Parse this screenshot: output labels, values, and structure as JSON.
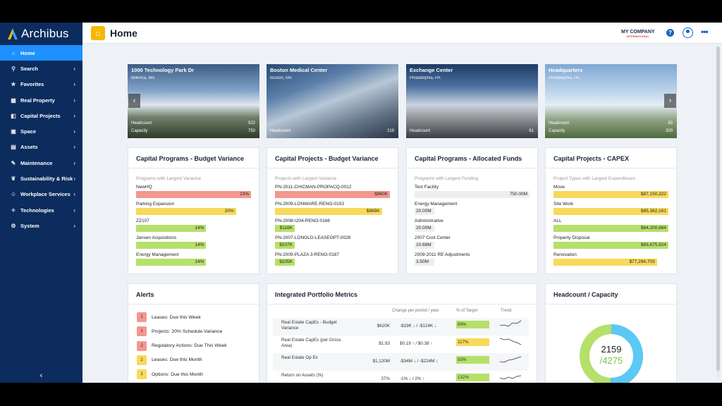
{
  "app": {
    "name": "Archibus"
  },
  "sidebar": {
    "items": [
      {
        "label": "Home",
        "icon": "home-icon",
        "glyph": "⌂",
        "active": true
      },
      {
        "label": "Search",
        "icon": "search-icon",
        "glyph": "⚲"
      },
      {
        "label": "Favorites",
        "icon": "star-icon",
        "glyph": "★"
      },
      {
        "label": "Real Property",
        "icon": "building-icon",
        "glyph": "▦"
      },
      {
        "label": "Capital Projects",
        "icon": "chart-icon",
        "glyph": "◧"
      },
      {
        "label": "Space",
        "icon": "space-icon",
        "glyph": "▣"
      },
      {
        "label": "Assets",
        "icon": "assets-icon",
        "glyph": "▤"
      },
      {
        "label": "Maintenance",
        "icon": "wrench-icon",
        "glyph": "✎"
      },
      {
        "label": "Sustainability & Risk",
        "icon": "leaf-icon",
        "glyph": "❦"
      },
      {
        "label": "Workplace Services",
        "icon": "people-icon",
        "glyph": "☺"
      },
      {
        "label": "Technologies",
        "icon": "bulb-icon",
        "glyph": "✧"
      },
      {
        "label": "System",
        "icon": "gear-icon",
        "glyph": "⚙"
      }
    ],
    "collapse_glyph": "‹"
  },
  "header": {
    "title": "Home",
    "company": "MY COMPANY",
    "company_sub": "INTERNATIONAL",
    "help": "?",
    "more": "•••"
  },
  "tiles": [
    {
      "name": "1000 Technology Park Dr",
      "sub": "Billerica, MA",
      "rows": [
        {
          "label": "Headcount",
          "value": "522"
        },
        {
          "label": "Capacity",
          "value": "750"
        }
      ]
    },
    {
      "name": "Boston Medical Center",
      "sub": "Boston, MA",
      "rows": [
        {
          "label": "Headcount",
          "value": "219"
        }
      ]
    },
    {
      "name": "Exchange Center",
      "sub": "Philadelphia, PA",
      "rows": [
        {
          "label": "Headcount",
          "value": "61"
        }
      ]
    },
    {
      "name": "Headquarters",
      "sub": "Philadelphia, PA",
      "rows": [
        {
          "label": "Headcount",
          "value": "83"
        },
        {
          "label": "Capacity",
          "value": "300"
        }
      ]
    }
  ],
  "tile_nav": {
    "prev": "‹",
    "next": "›"
  },
  "cards": [
    {
      "title": "Capital Programs - Budget Variance",
      "subtitle": "Programs with Largest Variance",
      "rows": [
        {
          "label": "NewHQ",
          "display": "23%",
          "fraction": 1.0,
          "color": "#f4978e"
        },
        {
          "label": "Parking Expansion",
          "display": "20%",
          "fraction": 0.87,
          "color": "#f8d95a"
        },
        {
          "label": "ZZ107",
          "display": "14%",
          "fraction": 0.61,
          "color": "#b5e06a"
        },
        {
          "label": "Jansen Acquisitions",
          "display": "14%",
          "fraction": 0.61,
          "color": "#b5e06a"
        },
        {
          "label": "Energy Management",
          "display": "14%",
          "fraction": 0.61,
          "color": "#b5e06a"
        }
      ]
    },
    {
      "title": "Capital Projects - Budget Variance",
      "subtitle": "Projects with Largest Variance",
      "rows": [
        {
          "label": "PN-2011-CHICMAN-PROPACQ-0012",
          "display": "$960K",
          "fraction": 1.0,
          "color": "#f4978e"
        },
        {
          "label": "PN-2009-LONWARE-RENO-0153",
          "display": "$889K",
          "fraction": 0.93,
          "color": "#f8d95a"
        },
        {
          "label": "PN-2008-I204-RENO-0166",
          "display": "$116K",
          "fraction": 0.14,
          "color": "#b5e06a"
        },
        {
          "label": "PN-2007-LONOLD-LEASEOPT-0028",
          "display": "$107K",
          "fraction": 0.14,
          "color": "#b5e06a"
        },
        {
          "label": "PN-2009-PLAZA 3-RENO-0187",
          "display": "$105K",
          "fraction": 0.14,
          "color": "#b5e06a"
        }
      ]
    },
    {
      "title": "Capital Programs - Allocated Funds",
      "subtitle": "Programs with Largest Funding",
      "rows": [
        {
          "label": "Test Facility",
          "display": "750.00M",
          "fraction": 1.0,
          "color": "#eeeeee"
        },
        {
          "label": "Energy Management",
          "display": "20.00M",
          "fraction": 0.17,
          "color": "#eeeeee",
          "left": true
        },
        {
          "label": "Administrative",
          "display": "20.00M",
          "fraction": 0.17,
          "color": "#eeeeee",
          "left": true
        },
        {
          "label": "2007 Cost Center",
          "display": "10.68M",
          "fraction": 0.17,
          "color": "#eeeeee",
          "left": true
        },
        {
          "label": "2009-2011 RE Adjustments",
          "display": "3.50M",
          "fraction": 0.17,
          "color": "#eeeeee",
          "left": true
        }
      ]
    },
    {
      "title": "Capital Projects - CAPEX",
      "subtitle": "Project Types with Largest Expenditures",
      "rows": [
        {
          "label": "Move",
          "display": "$87,150,322",
          "fraction": 1.0,
          "color": "#f8d95a"
        },
        {
          "label": "Site Work",
          "display": "$85,362,161",
          "fraction": 1.0,
          "color": "#f8d95a"
        },
        {
          "label": "ALL",
          "display": "$84,200,664",
          "fraction": 1.0,
          "color": "#b5e06a"
        },
        {
          "label": "Property Disposal",
          "display": "$83,675,924",
          "fraction": 1.0,
          "color": "#b5e06a"
        },
        {
          "label": "Renovation",
          "display": "$77,294,703",
          "fraction": 0.9,
          "color": "#f8d95a"
        }
      ]
    }
  ],
  "alerts": {
    "title": "Alerts",
    "items": [
      {
        "count": "1",
        "label": "Leases: Due this Week",
        "color": "#f4978e"
      },
      {
        "count": "1",
        "label": "Projects: 20% Schedule Variance",
        "color": "#f4978e"
      },
      {
        "count": "2",
        "label": "Regulatory Actions: Due This Week",
        "color": "#f4978e"
      },
      {
        "count": "2",
        "label": "Leases: Due this Month",
        "color": "#f8d95a"
      },
      {
        "count": "1",
        "label": "Options: Due this Month",
        "color": "#f8d95a"
      }
    ]
  },
  "metrics": {
    "title": "Integrated Portfolio Metrics",
    "col_change": "Change per period / year",
    "col_target": "% of Target",
    "col_trend": "Trend",
    "rows": [
      {
        "label": "Real Estate CapEx - Budget Variance",
        "value": "$620K",
        "change": "-$19K ↓ / -$124K ↓",
        "target": "89%",
        "target_color": "#b5e06a",
        "trend": [
          5,
          6,
          4,
          9,
          8,
          12
        ]
      },
      {
        "label": "Real Estate CapEx (per Gross Area)",
        "value": "$1.93",
        "change": "$0.19 ↑ / $0.38 ↑",
        "target": "117%",
        "target_color": "#f8d95a",
        "trend": [
          12,
          10,
          11,
          8,
          6,
          3
        ]
      },
      {
        "label": "Real Estate Op Ex",
        "value": "$1,120M",
        "change": "-$34M ↓ / -$224M ↓",
        "target": "93%",
        "target_color": "#b5e06a",
        "trend": [
          4,
          3,
          6,
          7,
          9,
          11
        ]
      },
      {
        "label": "Return on Assets (%)",
        "value": "37%",
        "change": "-1% ↓ / 2% ↑",
        "target": "132%",
        "target_color": "#b5e06a",
        "trend": [
          6,
          4,
          7,
          5,
          8,
          9
        ]
      }
    ]
  },
  "headcount": {
    "title": "Headcount / Capacity",
    "value": "2159",
    "capacity": "/4275",
    "headcount_num": 2159,
    "capacity_num": 4275,
    "colors": {
      "ring_used": "#5bc8f5",
      "ring_free": "#b5e06a"
    }
  }
}
